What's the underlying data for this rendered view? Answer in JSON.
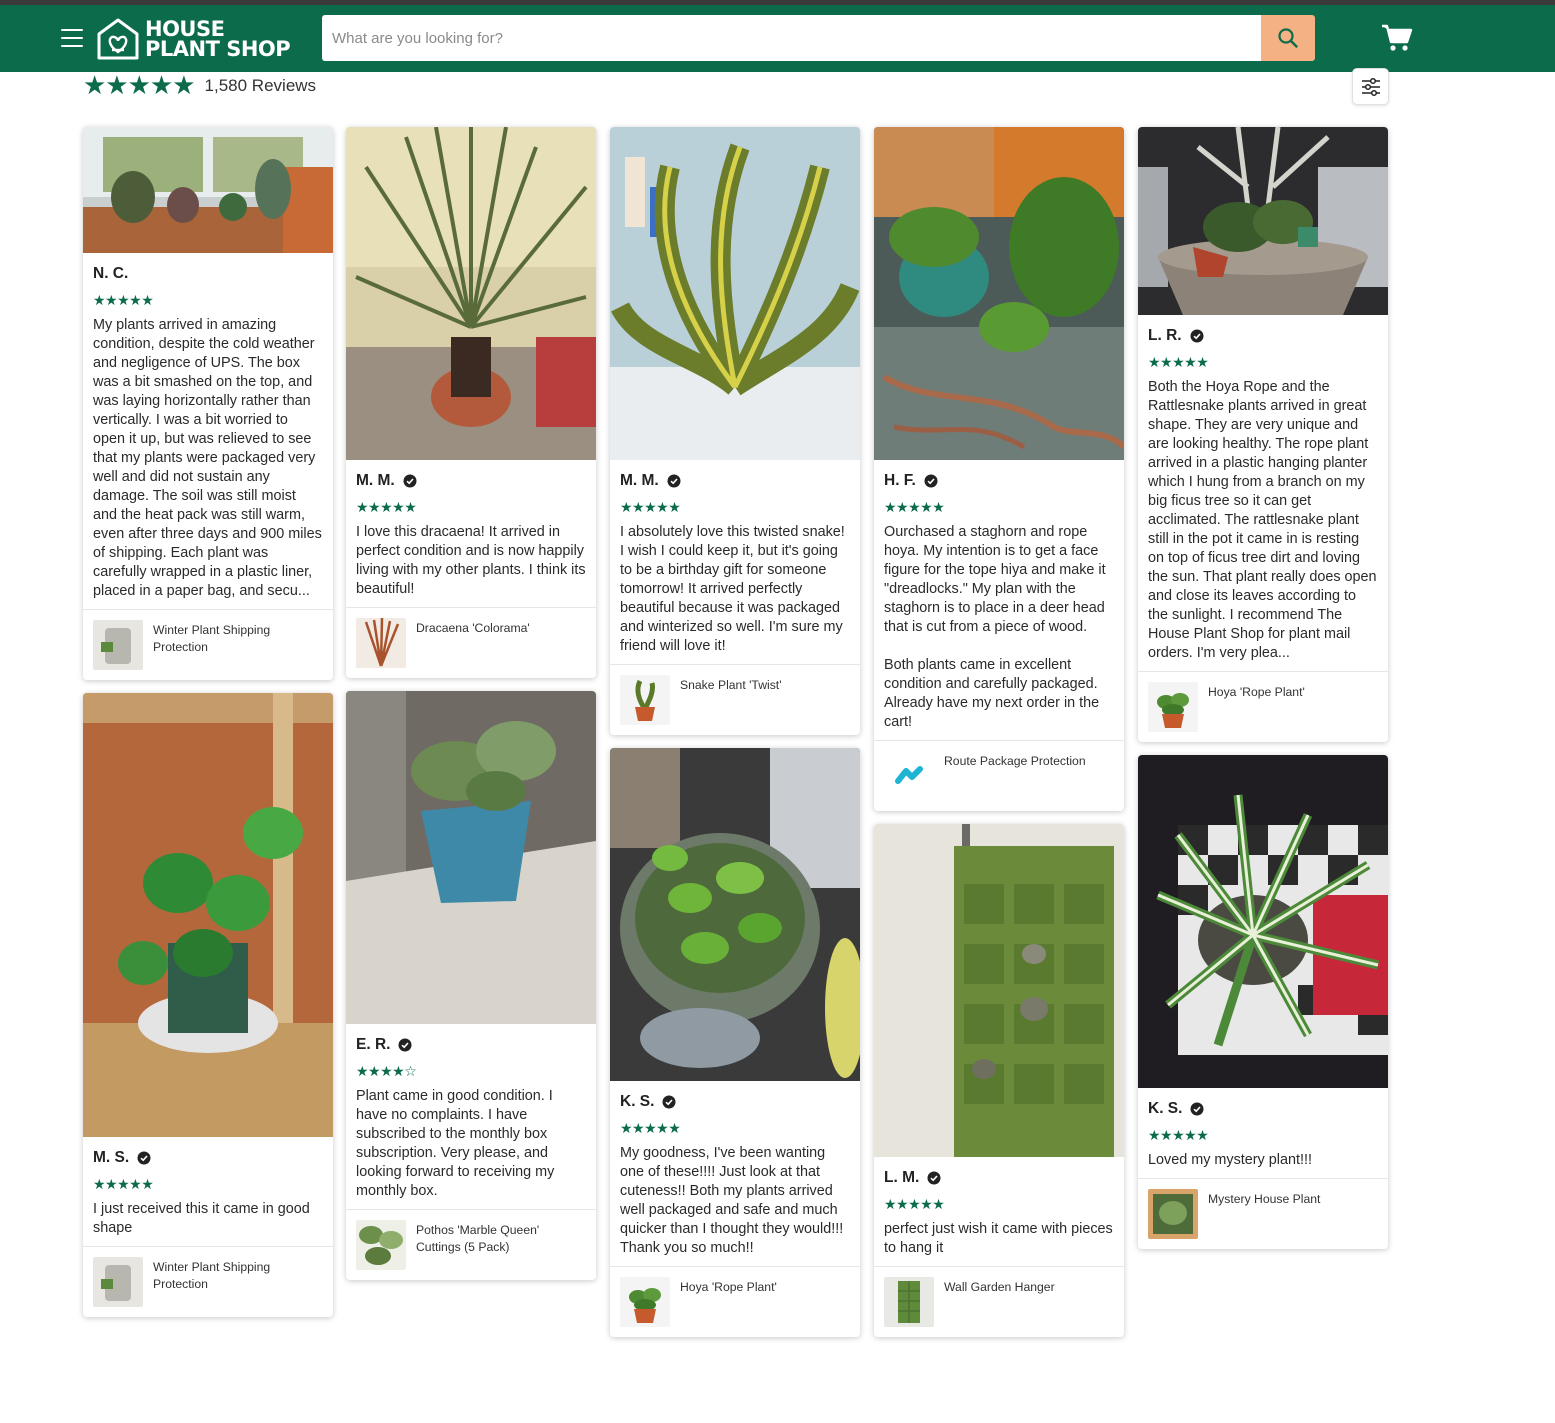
{
  "header": {
    "logo_line1": "HOUSE",
    "logo_line2": "PLANT SHOP",
    "search_placeholder": "What are you looking for?"
  },
  "summary": {
    "rating_stars": "★★★★★",
    "review_count": "1,580 Reviews"
  },
  "colors": {
    "brand_green": "#0b6b4b",
    "search_button": "#f4b183"
  },
  "icons": [
    "menu-icon",
    "search-icon",
    "cart-icon",
    "filter-icon",
    "verified-icon"
  ],
  "reviews": [
    {
      "name": "N. C.",
      "stars": "★★★★★",
      "text": "My plants arrived in amazing condition, despite the cold weather and negligence of UPS. The box was a bit smashed on the top, and was laying horizontally rather than vertically. I was a bit worried to open it up, but was relieved to see that my plants were packaged very well and did not sustain any damage. The soil was still moist and the heat pack was still warm, even after three days and 900 miles of shipping. Each plant was carefully wrapped in a plastic liner, placed in a paper bag, and secu...",
      "product": "Winter Plant Shipping Protection"
    },
    {
      "name": "M. S.",
      "stars": "★★★★★",
      "text": "I just received this it came in good shape",
      "product": "Winter Plant Shipping Protection"
    },
    {
      "name": "M. M.",
      "stars": "★★★★★",
      "text": "I love this dracaena!  It arrived in perfect condition and is now happily living with my other plants.  I think its beautiful!",
      "product": "Dracaena 'Colorama'"
    },
    {
      "name": "E. R.",
      "stars": "★★★★☆",
      "text": "Plant came in good condition. I have no complaints. I have subscribed to the monthly box subscription. Very please, and looking forward to receiving my monthly box.",
      "product": "Pothos 'Marble Queen' Cuttings (5 Pack)"
    },
    {
      "name": "M. M.",
      "stars": "★★★★★",
      "text": "I absolutely love this twisted snake!  I wish I could keep it, but it's going to be a birthday gift for someone tomorrow!  It arrived perfectly beautiful because it was packaged and winterized so well.  I'm sure my friend will love it!",
      "product": "Snake Plant 'Twist'"
    },
    {
      "name": "K. S.",
      "stars": "★★★★★",
      "text": "My goodness, I've been wanting one of these!!!! Just look at that cuteness!! Both my plants arrived well packaged and safe and much quicker than I thought they would!!! Thank you so much!!",
      "product": "Hoya 'Rope Plant'"
    },
    {
      "name": "H. F.",
      "stars": "★★★★★",
      "text": "Ourchased a staghorn and rope hoya. My intention is to get a face figure for the tope hiya and make it \"dreadlocks.\" My plan with the staghorn is to place in a deer head that is cut from a piece of wood.\n\nBoth plants came in excellent condition and carefully packaged. Already have my next order in the cart!",
      "product": "Route Package Protection"
    },
    {
      "name": "L. M.",
      "stars": "★★★★★",
      "text": "perfect just wish it came with pieces to hang it",
      "product": "Wall Garden Hanger"
    },
    {
      "name": "L. R.",
      "stars": "★★★★★",
      "text": "Both the Hoya Rope and the Rattlesnake plants arrived in great shape.  They are very unique and are looking healthy.  The rope plant arrived in a plastic hanging planter which I hung from a branch on my big ficus tree so it can get acclimated.  The rattlesnake plant still in the pot it came in is resting on top of ficus tree dirt and loving the sun.  That plant really does open and close its leaves according to the sunlight.  I recommend The House Plant Shop for plant mail orders.  I'm very plea...",
      "product": "Hoya 'Rope Plant'"
    },
    {
      "name": "K. S.",
      "stars": "★★★★★",
      "text": "Loved my mystery plant!!!",
      "product": "Mystery House Plant"
    }
  ]
}
